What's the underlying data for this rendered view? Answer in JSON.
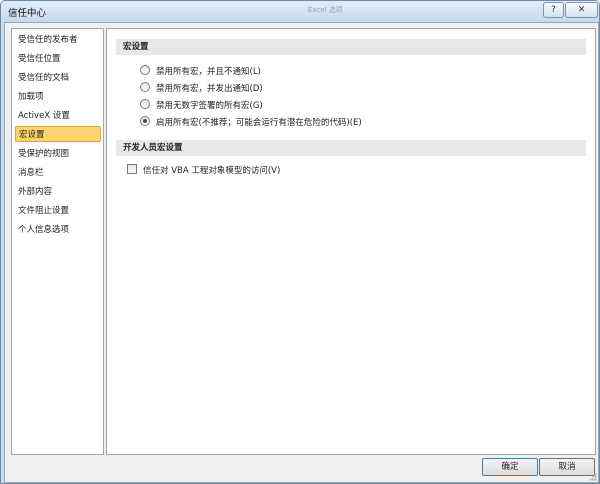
{
  "window": {
    "title": "信任中心",
    "ghost_title": "Excel 选项",
    "help_label": "?",
    "close_label": "✕"
  },
  "sidebar": {
    "items": [
      {
        "label": "受信任的发布者"
      },
      {
        "label": "受信任位置"
      },
      {
        "label": "受信任的文档"
      },
      {
        "label": "加载项"
      },
      {
        "label": "ActiveX 设置"
      },
      {
        "label": "宏设置",
        "active": true
      },
      {
        "label": "受保护的视图"
      },
      {
        "label": "消息栏"
      },
      {
        "label": "外部内容"
      },
      {
        "label": "文件阻止设置"
      },
      {
        "label": "个人信息选项"
      }
    ]
  },
  "macro_settings": {
    "header": "宏设置",
    "options": [
      {
        "label": "禁用所有宏，并且不通知(L)",
        "checked": false
      },
      {
        "label": "禁用所有宏，并发出通知(D)",
        "checked": false
      },
      {
        "label": "禁用无数字签署的所有宏(G)",
        "checked": false
      },
      {
        "label": "启用所有宏(不推荐；可能会运行有潜在危险的代码)(E)",
        "checked": true
      }
    ]
  },
  "developer_settings": {
    "header": "开发人员宏设置",
    "vba_access_label": "信任对 VBA 工程对象模型的访问(V)",
    "vba_access_checked": false
  },
  "buttons": {
    "ok_label": "确定",
    "cancel_label": "取消"
  },
  "colors": {
    "active_item_bg": "#fcd471",
    "active_item_border": "#e2a23b",
    "frame": "#c9daea",
    "section_header_bg": "#e8e8e8"
  }
}
